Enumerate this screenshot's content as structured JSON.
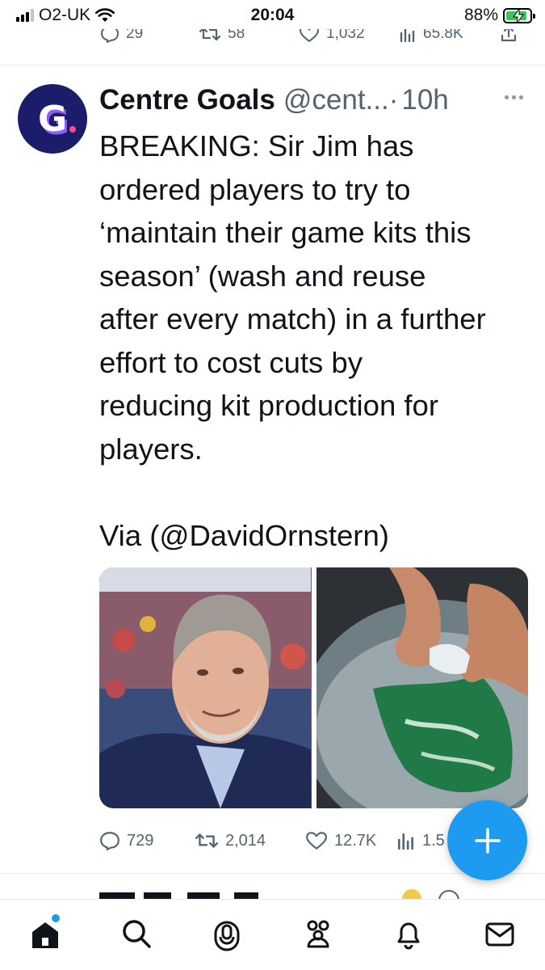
{
  "status_bar": {
    "carrier": "O2-UK",
    "time": "20:04",
    "battery_percent": "88%",
    "battery_level": 0.88,
    "signal_bars": 3
  },
  "previous_tweet": {
    "replies": "29",
    "retweets": "58",
    "likes": "1,032",
    "views": "65.8K"
  },
  "tweet": {
    "display_name": "Centre Goals",
    "handle": "@cent...",
    "separator": "·",
    "time_ago": "10h",
    "text": "BREAKING: Sir Jim has\nordered players to try to\n‘maintain their game kits this\nseason’ (wash and reuse\nafter every match) in a further\neffort to cost cuts by\nreducing kit production for\nplayers.\n\nVia (@DavidOrnstern)",
    "avatar_letter": "G",
    "media": [
      "portrait-photo",
      "washing-kit-photo"
    ],
    "replies": "729",
    "retweets": "2,014",
    "likes": "12.7K",
    "views": "1.5"
  },
  "fab": {
    "icon": "plus-icon"
  },
  "tabbar": {
    "items": [
      "home-icon",
      "search-icon",
      "spaces-icon",
      "communities-icon",
      "notifications-icon",
      "messages-icon"
    ],
    "active": "home-icon"
  },
  "colors": {
    "accent": "#1d9bf0",
    "text_primary": "#0f1419",
    "text_secondary": "#536471",
    "battery_green": "#34c759",
    "avatar_bg": "#1b1d6b"
  }
}
